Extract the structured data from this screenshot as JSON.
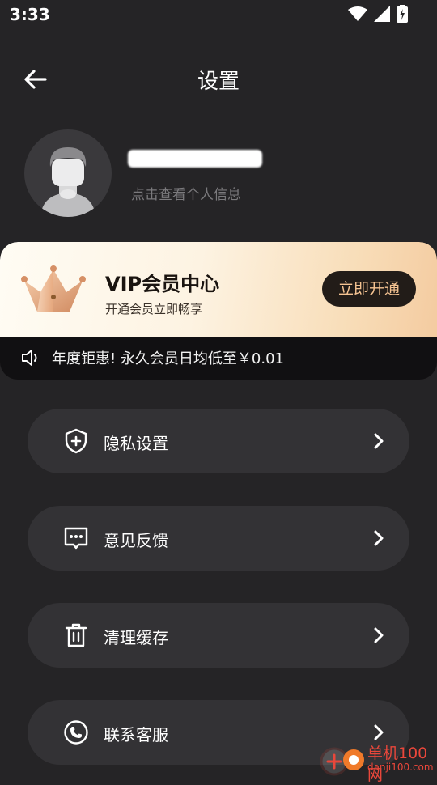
{
  "status_bar": {
    "time": "3:33",
    "icons": [
      "wifi-icon",
      "signal-icon",
      "battery-icon"
    ]
  },
  "header": {
    "title": "设置",
    "back_icon": "arrow-left-icon"
  },
  "profile": {
    "hint": "点击查看个人信息"
  },
  "vip": {
    "title": "VIP会员中心",
    "subtitle": "开通会员立即畅享",
    "button_label": "立即开通",
    "notice": "年度钜惠! 永久会员日均低至￥0.01",
    "accent_color": "#f5c392"
  },
  "menu": [
    {
      "label": "隐私设置",
      "icon": "shield-plus-icon"
    },
    {
      "label": "意见反馈",
      "icon": "chat-bubble-icon"
    },
    {
      "label": "清理缓存",
      "icon": "trash-icon"
    },
    {
      "label": "联系客服",
      "icon": "phone-icon"
    }
  ],
  "watermark": {
    "line1": "单机100网",
    "line2": "danji100.com"
  }
}
